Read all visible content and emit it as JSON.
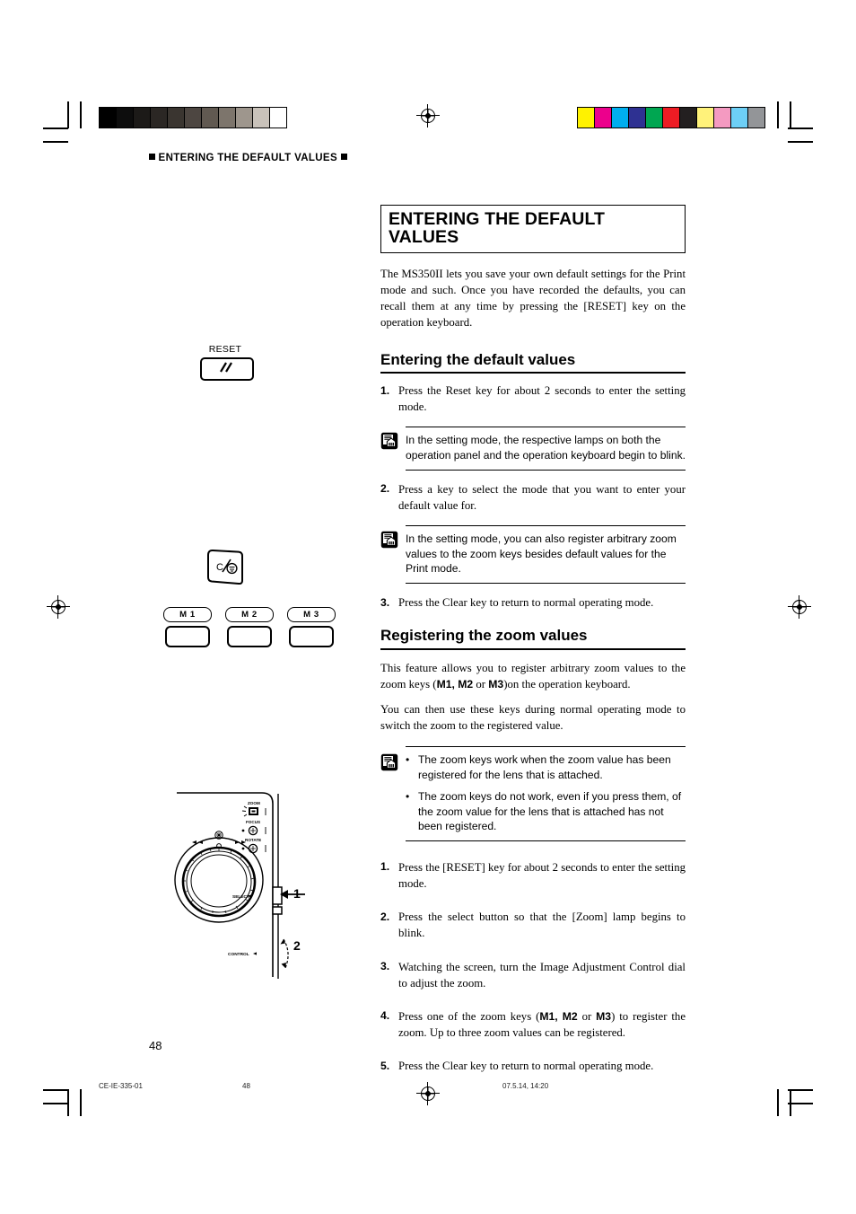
{
  "running_head": "ENTERING THE DEFAULT VALUES",
  "title": "ENTERING THE DEFAULT VALUES",
  "intro": "The MS350II lets you save your own default settings for the Print mode and such. Once you have recorded the defaults, you can recall them at any time by pressing the [RESET] key on the operation keyboard.",
  "section1": {
    "heading": "Entering the default values",
    "steps": [
      {
        "num": "1.",
        "text": "Press the Reset key for about 2 seconds to enter the setting mode."
      },
      {
        "num": "2.",
        "text": "Press a key to select the mode that you want to enter your default value for."
      },
      {
        "num": "3.",
        "text": "Press the Clear key to return to normal operating mode."
      }
    ],
    "note1": "In the setting mode, the respective lamps on both the operation panel and the operation keyboard begin to blink.",
    "note2": "In the setting mode, you can also register arbitrary zoom values to the zoom keys besides default values for the Print mode."
  },
  "section2": {
    "heading": "Registering the zoom values",
    "para1_a": "This feature allows you to register arbitrary zoom values to the zoom keys (",
    "para1_b": "M1, M2",
    "para1_c": " or ",
    "para1_d": "M3",
    "para1_e": ")on the operation keyboard.",
    "para2": "You can then use these keys during normal operating mode to switch the zoom to the registered value.",
    "note_bullets": [
      "The zoom keys work when the zoom value has been registered for the lens that is attached.",
      "The zoom keys do not work, even if you press them, of the zoom value for the lens that is attached has not been registered."
    ],
    "bullet_char": "•",
    "steps": [
      {
        "num": "1.",
        "text": "Press the [RESET] key for about 2 seconds to enter the setting mode."
      },
      {
        "num": "2.",
        "text": "Press the select button so that the [Zoom] lamp begins to blink."
      },
      {
        "num": "3.",
        "text": "Watching the screen, turn the Image Adjustment Control dial to adjust the zoom."
      },
      {
        "num": "4.",
        "text": "",
        "rich": true
      },
      {
        "num": "5.",
        "text": "Press the Clear key to return to normal operating mode."
      }
    ],
    "step4_a": "Press one of the zoom keys (",
    "step4_b": "M1, M2",
    "step4_c": " or ",
    "step4_d": "M3",
    "step4_e": ") to register the zoom. Up to three zoom values can be registered."
  },
  "illustrations": {
    "reset_key_label": "RESET",
    "clear_key_label": "C/",
    "memory_keys": [
      "M 1",
      "M 2",
      "M 3"
    ],
    "panel_labels": {
      "zoom": "ZOOM",
      "focus": "FOCUS",
      "rotate": "ROTATE",
      "select": "SELECT",
      "control": "CONTROL"
    },
    "callouts": [
      "1",
      "2"
    ]
  },
  "footer": {
    "page_number": "48",
    "doc_code": "CE-IE-335-01",
    "foot_page": "48",
    "timestamp": "07.5.14, 14:20"
  },
  "colorbars": {
    "gray": [
      "#000000",
      "#0d0d0d",
      "#1c1a18",
      "#2b2724",
      "#3a3530",
      "#4d4641",
      "#615951",
      "#7d756c",
      "#9e968d",
      "#c9c2ba",
      "#ffffff"
    ],
    "color": [
      "#fff200",
      "#ec008c",
      "#00aeef",
      "#2e3192",
      "#00a651",
      "#ed1c24",
      "#231f20",
      "#fff27a",
      "#f49ac1",
      "#6dcff6",
      "#939598"
    ]
  }
}
